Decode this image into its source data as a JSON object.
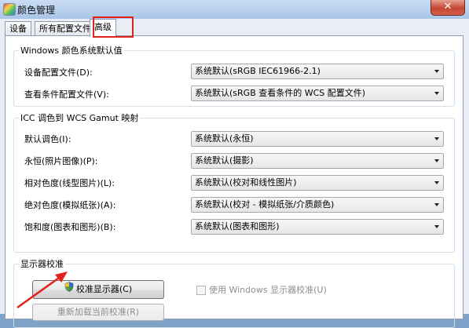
{
  "window": {
    "title": "颜色管理",
    "close_label": "✕"
  },
  "tabs": [
    {
      "label": "设备"
    },
    {
      "label": "所有配置文件"
    },
    {
      "label": "高级"
    }
  ],
  "windows_defaults": {
    "legend": "Windows 颜色系统默认值",
    "rows": [
      {
        "label": "设备配置文件(D):",
        "value": "系统默认(sRGB IEC61966-2.1)"
      },
      {
        "label": "查看条件配置文件(V):",
        "value": "系统默认(sRGB 查看条件的 WCS 配置文件)"
      }
    ]
  },
  "gamut_mapping": {
    "legend": "ICC 调色到 WCS Gamut 映射",
    "rows": [
      {
        "label": "默认调色(I):",
        "value": "系统默认(永恒)"
      },
      {
        "label": "永恒(照片图像)(P):",
        "value": "系统默认(摄影)"
      },
      {
        "label": "相对色度(线型图片)(L):",
        "value": "系统默认(校对和线性图片)"
      },
      {
        "label": "绝对色度(模拟纸张)(A):",
        "value": "系统默认(校对 - 模拟纸张/介质颜色)"
      },
      {
        "label": "饱和度(图表和图形)(B):",
        "value": "系统默认(图表和图形)"
      }
    ]
  },
  "calibration": {
    "legend": "显示器校准",
    "calibrate_button": "校准显示器(C)",
    "reload_button": "重新加载当前校准(R)",
    "use_windows_calibration": "使用 Windows 显示器校准(U)"
  },
  "colors": {
    "highlight": "#e2211c",
    "annotation_arrow": "#e2211c"
  }
}
